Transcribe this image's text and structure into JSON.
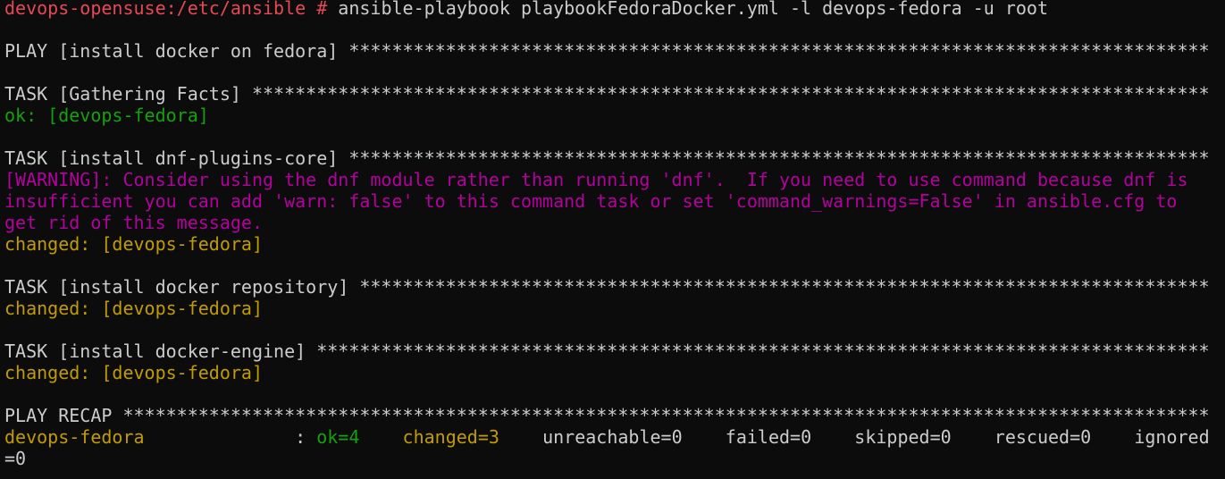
{
  "colors": {
    "background": "#0c0c0c",
    "default": "#cccccc",
    "red": "#e74856",
    "green": "#13a10e",
    "yellow": "#c19c00",
    "magenta": "#b4009e"
  },
  "lines": [
    {
      "kind": "command",
      "segments": [
        {
          "text": "devops-opensuse:/etc/ansible # ",
          "color": "red"
        },
        {
          "text": "ansible-playbook playbookFedoraDocker.yml -l devops-fedora -u root",
          "color": "default"
        }
      ]
    },
    {
      "kind": "blank",
      "segments": []
    },
    {
      "kind": "play-header",
      "segments": [
        {
          "text": "PLAY [install docker on fedora] ********************************************************************************",
          "color": "default"
        }
      ]
    },
    {
      "kind": "blank",
      "segments": []
    },
    {
      "kind": "task-header",
      "segments": [
        {
          "text": "TASK [Gathering Facts] *****************************************************************************************",
          "color": "default"
        }
      ]
    },
    {
      "kind": "task-result",
      "segments": [
        {
          "text": "ok: [devops-fedora]",
          "color": "green"
        }
      ]
    },
    {
      "kind": "blank",
      "segments": []
    },
    {
      "kind": "task-header",
      "segments": [
        {
          "text": "TASK [install dnf-plugins-core] ********************************************************************************",
          "color": "default"
        }
      ]
    },
    {
      "kind": "warning",
      "segments": [
        {
          "text": "[WARNING]: Consider using the dnf module rather than running 'dnf'.  If you need to use command because dnf is",
          "color": "magenta"
        }
      ]
    },
    {
      "kind": "warning",
      "segments": [
        {
          "text": "insufficient you can add 'warn: false' to this command task or set 'command_warnings=False' in ansible.cfg to",
          "color": "magenta"
        }
      ]
    },
    {
      "kind": "warning",
      "segments": [
        {
          "text": "get rid of this message.",
          "color": "magenta"
        }
      ]
    },
    {
      "kind": "task-result",
      "segments": [
        {
          "text": "changed: [devops-fedora]",
          "color": "yellow"
        }
      ]
    },
    {
      "kind": "blank",
      "segments": []
    },
    {
      "kind": "task-header",
      "segments": [
        {
          "text": "TASK [install docker repository] *******************************************************************************",
          "color": "default"
        }
      ]
    },
    {
      "kind": "task-result",
      "segments": [
        {
          "text": "changed: [devops-fedora]",
          "color": "yellow"
        }
      ]
    },
    {
      "kind": "blank",
      "segments": []
    },
    {
      "kind": "task-header",
      "segments": [
        {
          "text": "TASK [install docker-engine] ***********************************************************************************",
          "color": "default"
        }
      ]
    },
    {
      "kind": "task-result",
      "segments": [
        {
          "text": "changed: [devops-fedora]",
          "color": "yellow"
        }
      ]
    },
    {
      "kind": "blank",
      "segments": []
    },
    {
      "kind": "recap-header",
      "segments": [
        {
          "text": "PLAY RECAP *****************************************************************************************************",
          "color": "default"
        }
      ]
    },
    {
      "kind": "recap",
      "segments": [
        {
          "text": "devops-fedora",
          "color": "yellow"
        },
        {
          "text": "              : ",
          "color": "default"
        },
        {
          "text": "ok=4",
          "color": "green"
        },
        {
          "text": "    ",
          "color": "default"
        },
        {
          "text": "changed=3",
          "color": "yellow"
        },
        {
          "text": "    unreachable=0    failed=0    skipped=0    rescued=0    ignored",
          "color": "default"
        }
      ]
    },
    {
      "kind": "recap",
      "segments": [
        {
          "text": "=0",
          "color": "default"
        }
      ]
    }
  ]
}
